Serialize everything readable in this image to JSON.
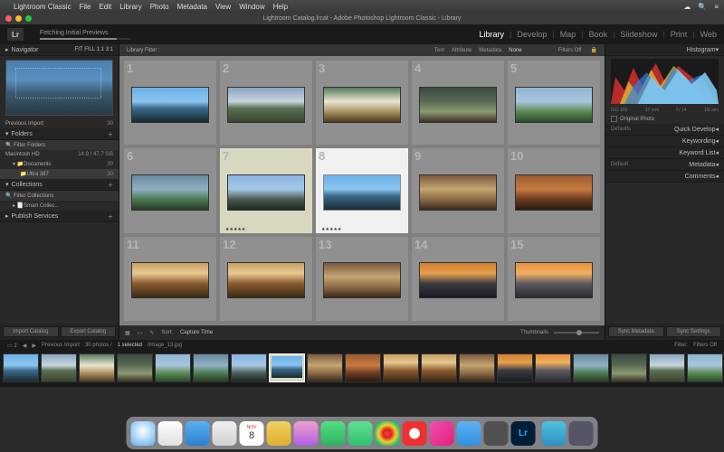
{
  "menubar": {
    "app": "Lightroom Classic",
    "items": [
      "File",
      "Edit",
      "Library",
      "Photo",
      "Metadata",
      "View",
      "Window",
      "Help"
    ]
  },
  "window": {
    "title": "Lightroom Catalog.lrcat - Adobe Photoshop Lightroom Classic - Library"
  },
  "header": {
    "logo": "Lr",
    "status": "Fetching Initial Previews",
    "modules": [
      "Library",
      "Develop",
      "Map",
      "Book",
      "Slideshow",
      "Print",
      "Web"
    ],
    "active_module": "Library"
  },
  "left": {
    "navigator": {
      "title": "Navigator",
      "opts": "FIT  FILL  1:1  3:1"
    },
    "previous_import": {
      "label": "Previous Import",
      "count": "30"
    },
    "folders": {
      "title": "Folders"
    },
    "volume": {
      "name": "Macintosh HD",
      "space": "14.9 / 47.7 GB"
    },
    "folder1": {
      "name": "Documents",
      "count": "30"
    },
    "folder2": {
      "name": "Ultra 387",
      "count": "30"
    },
    "collections": {
      "title": "Collections"
    },
    "smart": {
      "name": "Smart Collec..."
    },
    "publish": {
      "title": "Publish Services"
    },
    "import_btn": "Import Catalog",
    "export_btn": "Export Catalog"
  },
  "right": {
    "histogram": {
      "title": "Histogram"
    },
    "exif": {
      "iso": "ISO 100",
      "focal": "17 mm",
      "aperture": "f / 14",
      "shutter": "1/5 sec"
    },
    "original": "Original Photo",
    "quick": {
      "title": "Quick Develop",
      "preset": "Defaults"
    },
    "keywording": "Keywording",
    "keylist": "Keyword List",
    "metadata": {
      "title": "Metadata",
      "preset": "Default"
    },
    "comments": "Comments",
    "sync_meta": "Sync Metadata",
    "sync_set": "Sync Settings"
  },
  "filterbar": {
    "label": "Library Filter :",
    "tabs": [
      "Text",
      "Attribute",
      "Metadata",
      "None"
    ],
    "filters_off": "Filters Off"
  },
  "grid_numbers": [
    "1",
    "2",
    "3",
    "4",
    "5",
    "6",
    "7",
    "8",
    "9",
    "10",
    "11",
    "12",
    "13",
    "14",
    "15"
  ],
  "toolbar": {
    "sort": "Sort:",
    "sort_val": "Capture Time",
    "thumbnails": "Thumbnails"
  },
  "infobar": {
    "source": "Previous Import",
    "count": "30 photos /",
    "selected": "1 selected",
    "file": "/Image_13.jpg",
    "filter": "Filter:",
    "filters_off": "Filters Off"
  },
  "stars7": "★★★★★",
  "stars8": "★★★★★"
}
